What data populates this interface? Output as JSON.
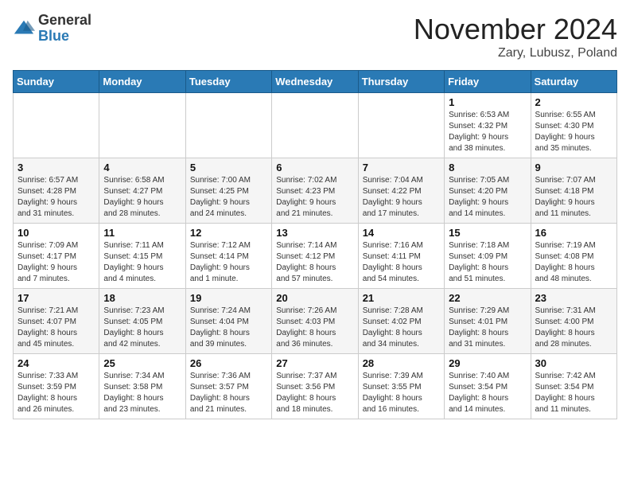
{
  "logo": {
    "general": "General",
    "blue": "Blue"
  },
  "title": "November 2024",
  "location": "Zary, Lubusz, Poland",
  "weekdays": [
    "Sunday",
    "Monday",
    "Tuesday",
    "Wednesday",
    "Thursday",
    "Friday",
    "Saturday"
  ],
  "weeks": [
    [
      {
        "day": "",
        "info": ""
      },
      {
        "day": "",
        "info": ""
      },
      {
        "day": "",
        "info": ""
      },
      {
        "day": "",
        "info": ""
      },
      {
        "day": "",
        "info": ""
      },
      {
        "day": "1",
        "info": "Sunrise: 6:53 AM\nSunset: 4:32 PM\nDaylight: 9 hours\nand 38 minutes."
      },
      {
        "day": "2",
        "info": "Sunrise: 6:55 AM\nSunset: 4:30 PM\nDaylight: 9 hours\nand 35 minutes."
      }
    ],
    [
      {
        "day": "3",
        "info": "Sunrise: 6:57 AM\nSunset: 4:28 PM\nDaylight: 9 hours\nand 31 minutes."
      },
      {
        "day": "4",
        "info": "Sunrise: 6:58 AM\nSunset: 4:27 PM\nDaylight: 9 hours\nand 28 minutes."
      },
      {
        "day": "5",
        "info": "Sunrise: 7:00 AM\nSunset: 4:25 PM\nDaylight: 9 hours\nand 24 minutes."
      },
      {
        "day": "6",
        "info": "Sunrise: 7:02 AM\nSunset: 4:23 PM\nDaylight: 9 hours\nand 21 minutes."
      },
      {
        "day": "7",
        "info": "Sunrise: 7:04 AM\nSunset: 4:22 PM\nDaylight: 9 hours\nand 17 minutes."
      },
      {
        "day": "8",
        "info": "Sunrise: 7:05 AM\nSunset: 4:20 PM\nDaylight: 9 hours\nand 14 minutes."
      },
      {
        "day": "9",
        "info": "Sunrise: 7:07 AM\nSunset: 4:18 PM\nDaylight: 9 hours\nand 11 minutes."
      }
    ],
    [
      {
        "day": "10",
        "info": "Sunrise: 7:09 AM\nSunset: 4:17 PM\nDaylight: 9 hours\nand 7 minutes."
      },
      {
        "day": "11",
        "info": "Sunrise: 7:11 AM\nSunset: 4:15 PM\nDaylight: 9 hours\nand 4 minutes."
      },
      {
        "day": "12",
        "info": "Sunrise: 7:12 AM\nSunset: 4:14 PM\nDaylight: 9 hours\nand 1 minute."
      },
      {
        "day": "13",
        "info": "Sunrise: 7:14 AM\nSunset: 4:12 PM\nDaylight: 8 hours\nand 57 minutes."
      },
      {
        "day": "14",
        "info": "Sunrise: 7:16 AM\nSunset: 4:11 PM\nDaylight: 8 hours\nand 54 minutes."
      },
      {
        "day": "15",
        "info": "Sunrise: 7:18 AM\nSunset: 4:09 PM\nDaylight: 8 hours\nand 51 minutes."
      },
      {
        "day": "16",
        "info": "Sunrise: 7:19 AM\nSunset: 4:08 PM\nDaylight: 8 hours\nand 48 minutes."
      }
    ],
    [
      {
        "day": "17",
        "info": "Sunrise: 7:21 AM\nSunset: 4:07 PM\nDaylight: 8 hours\nand 45 minutes."
      },
      {
        "day": "18",
        "info": "Sunrise: 7:23 AM\nSunset: 4:05 PM\nDaylight: 8 hours\nand 42 minutes."
      },
      {
        "day": "19",
        "info": "Sunrise: 7:24 AM\nSunset: 4:04 PM\nDaylight: 8 hours\nand 39 minutes."
      },
      {
        "day": "20",
        "info": "Sunrise: 7:26 AM\nSunset: 4:03 PM\nDaylight: 8 hours\nand 36 minutes."
      },
      {
        "day": "21",
        "info": "Sunrise: 7:28 AM\nSunset: 4:02 PM\nDaylight: 8 hours\nand 34 minutes."
      },
      {
        "day": "22",
        "info": "Sunrise: 7:29 AM\nSunset: 4:01 PM\nDaylight: 8 hours\nand 31 minutes."
      },
      {
        "day": "23",
        "info": "Sunrise: 7:31 AM\nSunset: 4:00 PM\nDaylight: 8 hours\nand 28 minutes."
      }
    ],
    [
      {
        "day": "24",
        "info": "Sunrise: 7:33 AM\nSunset: 3:59 PM\nDaylight: 8 hours\nand 26 minutes."
      },
      {
        "day": "25",
        "info": "Sunrise: 7:34 AM\nSunset: 3:58 PM\nDaylight: 8 hours\nand 23 minutes."
      },
      {
        "day": "26",
        "info": "Sunrise: 7:36 AM\nSunset: 3:57 PM\nDaylight: 8 hours\nand 21 minutes."
      },
      {
        "day": "27",
        "info": "Sunrise: 7:37 AM\nSunset: 3:56 PM\nDaylight: 8 hours\nand 18 minutes."
      },
      {
        "day": "28",
        "info": "Sunrise: 7:39 AM\nSunset: 3:55 PM\nDaylight: 8 hours\nand 16 minutes."
      },
      {
        "day": "29",
        "info": "Sunrise: 7:40 AM\nSunset: 3:54 PM\nDaylight: 8 hours\nand 14 minutes."
      },
      {
        "day": "30",
        "info": "Sunrise: 7:42 AM\nSunset: 3:54 PM\nDaylight: 8 hours\nand 11 minutes."
      }
    ]
  ]
}
